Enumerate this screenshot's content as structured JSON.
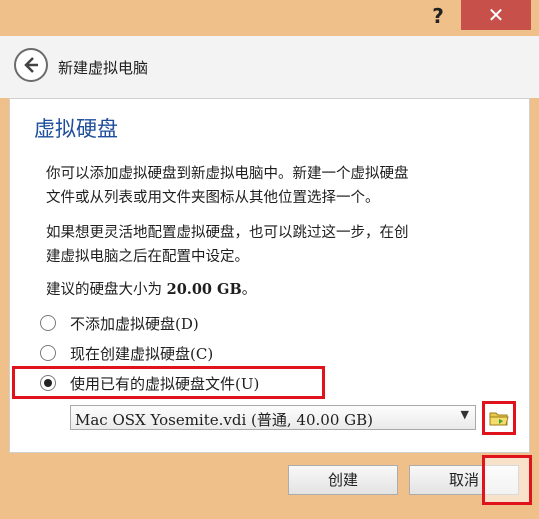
{
  "titlebar": {
    "help_label": "?",
    "close_label": "✕"
  },
  "wizard": {
    "title": "新建虚拟电脑"
  },
  "page": {
    "title": "虚拟硬盘",
    "para1_line1": "你可以添加虚拟硬盘到新虚拟电脑中。新建一个虚拟硬盘",
    "para1_line2": "文件或从列表或用文件夹图标从其他位置选择一个。",
    "para2_line1": "如果想更灵活地配置虚拟硬盘，也可以跳过这一步，在创",
    "para2_line2": "建虚拟电脑之后在配置中设定。",
    "recommend_prefix": "建议的硬盘大小为 ",
    "recommend_size": "20.00 GB",
    "recommend_suffix": "。"
  },
  "options": [
    {
      "label": "不添加虚拟硬盘(D)",
      "checked": false
    },
    {
      "label": "现在创建虚拟硬盘(C)",
      "checked": false
    },
    {
      "label": "使用已有的虚拟硬盘文件(U)",
      "checked": true
    }
  ],
  "disk_select": {
    "value": "Mac OSX Yosemite.vdi (普通, 40.00 GB)"
  },
  "icons": {
    "back": "back-arrow-icon",
    "folder": "folder-icon",
    "dropdown": "chevron-down-icon"
  },
  "buttons": {
    "create": "创建",
    "cancel": "取消"
  },
  "colors": {
    "accent_title": "#1f4e9c",
    "close": "#c7504b",
    "highlight": "#e0121b"
  }
}
